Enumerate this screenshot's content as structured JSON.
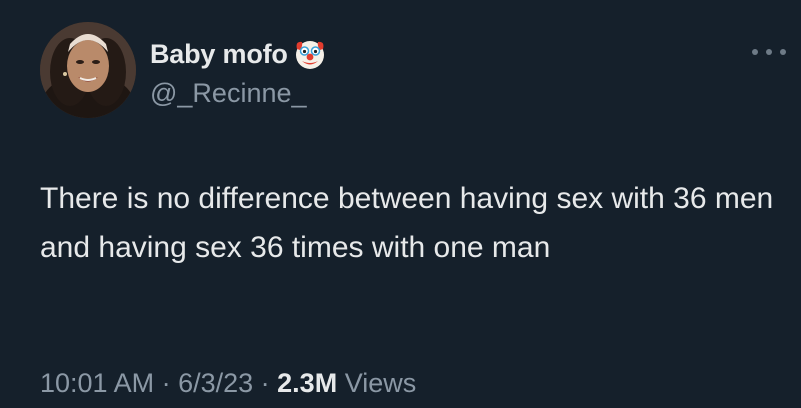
{
  "author": {
    "display_name": "Baby mofo",
    "emoji_icon": "clown-face-icon",
    "handle": "@_Recinne_"
  },
  "tweet": {
    "text": "There is no difference between having sex with 36 men and having sex 36 times with one man"
  },
  "meta": {
    "time": "10:01 AM",
    "sep1": " · ",
    "date": "6/3/23",
    "sep2": " · ",
    "views_count": "2.3M",
    "views_label": " Views"
  },
  "icons": {
    "more": "more-horizontal-icon",
    "avatar": "avatar"
  },
  "colors": {
    "background": "#15202b",
    "primary_text": "#e7e9ea",
    "secondary_text": "#8b98a5"
  }
}
